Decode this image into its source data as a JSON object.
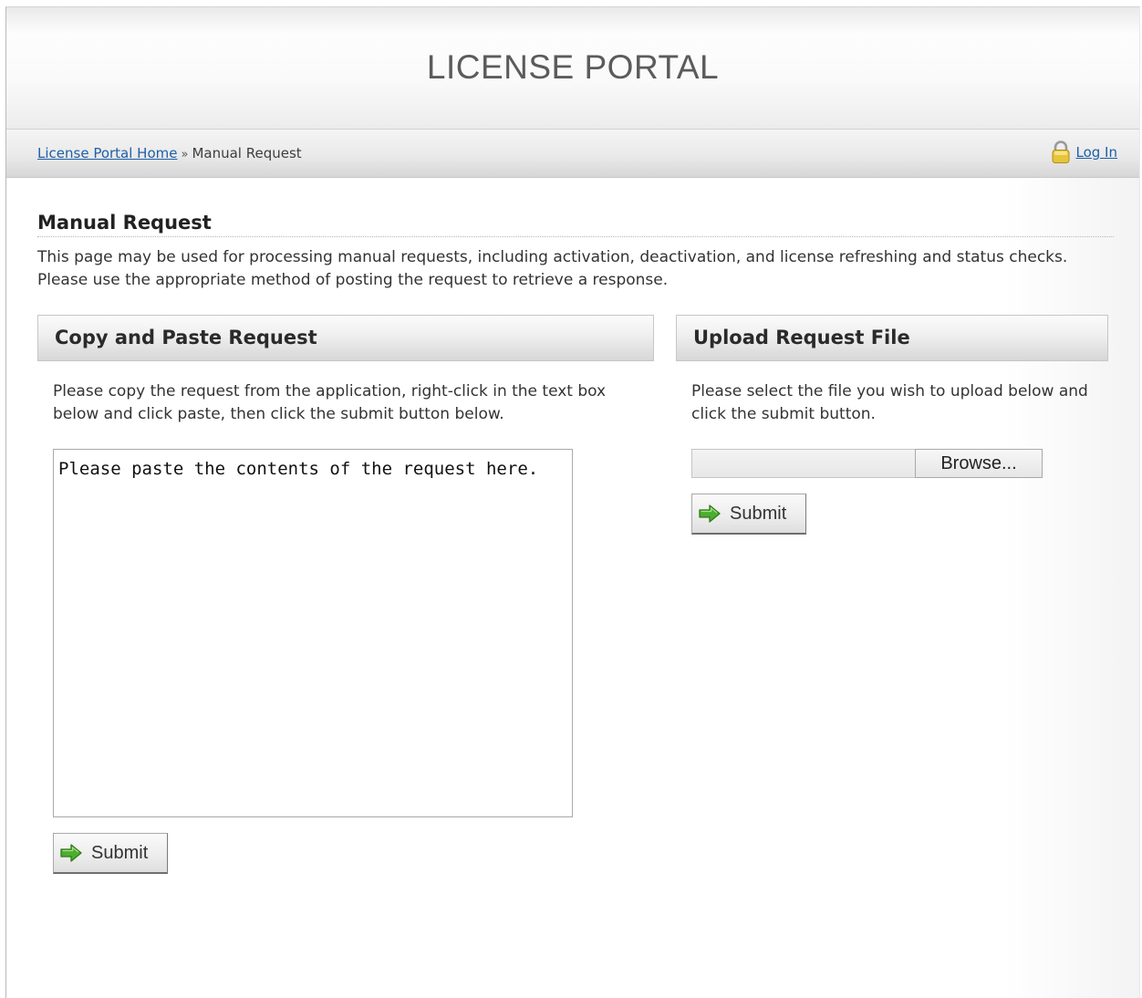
{
  "header": {
    "title": "LICENSE PORTAL"
  },
  "navbar": {
    "breadcrumb": {
      "home_link": "License Portal Home",
      "separator": "»",
      "current": "Manual Request"
    },
    "login": {
      "icon": "lock-icon",
      "label": "Log In"
    }
  },
  "main": {
    "title": "Manual Request",
    "intro": "This page may be used for processing manual requests, including activation, deactivation, and license refreshing and status checks. Please use the appropriate method of posting the request to retrieve a response."
  },
  "copy_paste_panel": {
    "title": "Copy and Paste Request",
    "description": "Please copy the request from the application, right-click in the text box below and click paste, then click the submit button below.",
    "textarea_value": "Please paste the contents of the request here.",
    "submit_label": "Submit",
    "submit_icon": "green-arrow-icon"
  },
  "upload_panel": {
    "title": "Upload Request File",
    "description": "Please select the file you wish to upload below and click the submit button.",
    "file_value": "",
    "browse_label": "Browse...",
    "submit_label": "Submit",
    "submit_icon": "green-arrow-icon"
  },
  "colors": {
    "link": "#1f5fa8",
    "title_text": "#5b5b5b",
    "arrow_green": "#4cae2f",
    "lock_gold": "#e8c43a"
  }
}
